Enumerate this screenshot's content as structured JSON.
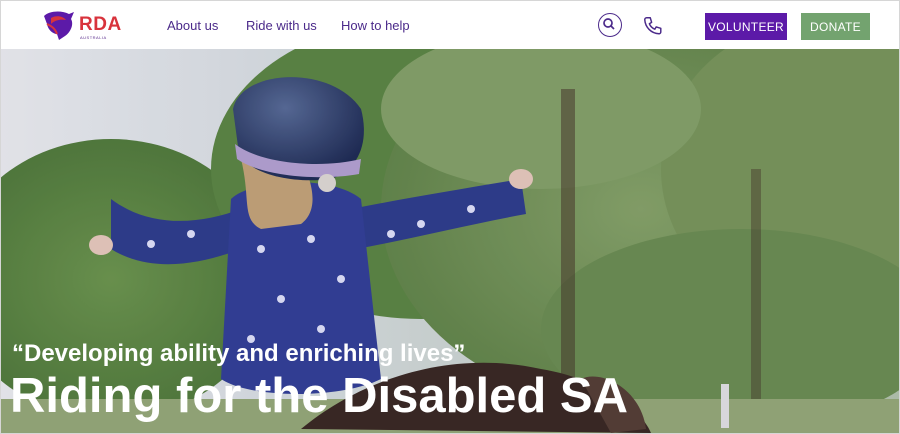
{
  "logo": {
    "text": "RDA",
    "subtext": "AUSTRALIA"
  },
  "nav": {
    "items": [
      {
        "label": "About us"
      },
      {
        "label": "Ride with us"
      },
      {
        "label": "How to help"
      }
    ]
  },
  "header_actions": {
    "search_icon": "search-icon",
    "phone_icon": "phone-icon",
    "volunteer_label": "VOLUNTEER",
    "donate_label": "DONATE"
  },
  "hero": {
    "tagline": "“Developing ability and enriching lives”",
    "title": "Riding for the Disabled SA"
  },
  "colors": {
    "brand_purple": "#5c1aa8",
    "nav_purple": "#4b2a8a",
    "donate_green": "#73a36f",
    "logo_red": "#d8333c"
  }
}
